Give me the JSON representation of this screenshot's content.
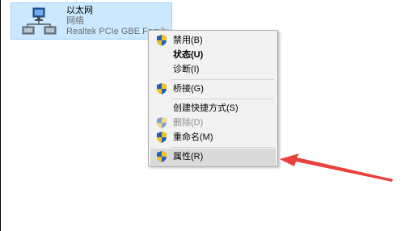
{
  "network_adapter": {
    "name": "以太网",
    "status": "网络",
    "adapter": "Realtek PCIe GBE Family Controller",
    "icon": "network-adapter-icon"
  },
  "context_menu": {
    "items": [
      {
        "label": "禁用(B)",
        "icon": "uac-shield-icon"
      },
      {
        "label": "状态(U)"
      },
      {
        "label": "诊断(I)"
      },
      {
        "label": "桥接(G)",
        "icon": "uac-shield-icon"
      },
      {
        "label": "创建快捷方式(S)"
      },
      {
        "label": "删除(D)",
        "icon": "uac-shield-icon"
      },
      {
        "label": "重命名(M)",
        "icon": "uac-shield-icon"
      },
      {
        "label": "属性(R)",
        "icon": "uac-shield-icon"
      }
    ]
  },
  "colors": {
    "selection": "#cce8ff",
    "menu_background": "#f2f2f2",
    "menu_highlight": "#dadada",
    "arrow": "#e8403a"
  }
}
